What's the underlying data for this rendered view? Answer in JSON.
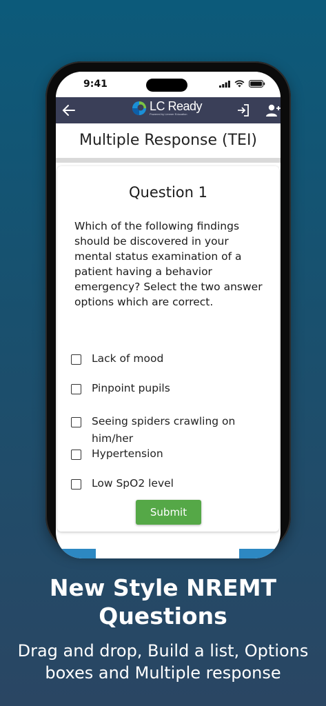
{
  "status_bar": {
    "time": "9:41"
  },
  "app_bar": {
    "logo_text": "LC Ready",
    "logo_subtext": "Powered by Limmer Education",
    "back_icon": "arrow-left-icon",
    "login_icon": "login-icon",
    "add_user_icon": "add-user-icon"
  },
  "page": {
    "title": "Multiple Response (TEI)"
  },
  "question": {
    "title": "Question 1",
    "text": "Which of the following findings should be discovered in your mental status examination of a patient having a behavior emergency? Select the two answer options which are correct.",
    "options": [
      {
        "label": "Lack of mood",
        "checked": false
      },
      {
        "label": "Pinpoint pupils",
        "checked": false
      },
      {
        "label": "Seeing spiders crawling on him/her",
        "checked": false
      },
      {
        "label": "Hypertension",
        "checked": false
      },
      {
        "label": "Low SpO2 level",
        "checked": false
      }
    ],
    "submit_label": "Submit"
  },
  "promo": {
    "headline": "New Style NREMT Questions",
    "subline": "Drag and drop, Build a list, Options boxes and Multiple response"
  },
  "colors": {
    "app_bar": "#3a3f58",
    "submit": "#55a847",
    "background_top": "#0c5a7a",
    "background_bottom": "#2a4663"
  }
}
